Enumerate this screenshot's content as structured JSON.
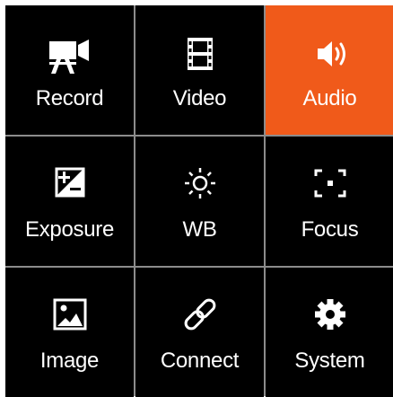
{
  "accent_color": "#f05a1a",
  "menu": {
    "active_item": "Audio",
    "items": [
      {
        "label": "Record",
        "icon": "camera-icon"
      },
      {
        "label": "Video",
        "icon": "film-icon"
      },
      {
        "label": "Audio",
        "icon": "speaker-icon"
      },
      {
        "label": "Exposure",
        "icon": "exposure-icon"
      },
      {
        "label": "WB",
        "icon": "sun-icon"
      },
      {
        "label": "Focus",
        "icon": "focus-icon"
      },
      {
        "label": "Image",
        "icon": "image-icon"
      },
      {
        "label": "Connect",
        "icon": "link-icon"
      },
      {
        "label": "System",
        "icon": "gear-icon"
      }
    ]
  }
}
